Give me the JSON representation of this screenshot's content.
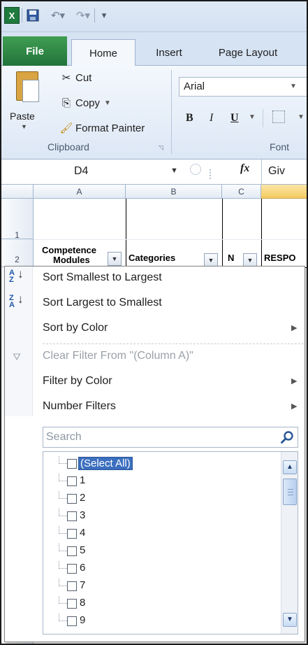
{
  "app": {
    "icon_letter": "X"
  },
  "tabs": {
    "file": "File",
    "home": "Home",
    "insert": "Insert",
    "page_layout": "Page Layout"
  },
  "ribbon": {
    "paste": "Paste",
    "cut": "Cut",
    "copy": "Copy",
    "format_painter": "Format Painter",
    "clipboard_group": "Clipboard",
    "font_name": "Arial",
    "bold": "B",
    "italic": "I",
    "underline": "U",
    "font_group": "Font"
  },
  "formula_bar": {
    "name_box": "D4",
    "fx": "fx",
    "formula": "Giv"
  },
  "sheet": {
    "columns": [
      "A",
      "B",
      "C"
    ],
    "rows": [
      "1",
      "2"
    ],
    "header_a_line1": "Competence",
    "header_a_line2": "Modules",
    "header_b": "Categories",
    "header_c": "N",
    "header_d": "RESPO"
  },
  "filter_menu": {
    "sort_asc": "Sort Smallest to Largest",
    "sort_desc": "Sort Largest to Smallest",
    "sort_by_color": "Sort by Color",
    "clear_filter": "Clear Filter From \"(Column A)\"",
    "filter_by_color": "Filter by Color",
    "number_filters": "Number Filters",
    "search_placeholder": "Search",
    "items": [
      {
        "label": "(Select All)",
        "checked": false,
        "selected": true
      },
      {
        "label": "1",
        "checked": false
      },
      {
        "label": "2",
        "checked": false
      },
      {
        "label": "3",
        "checked": false
      },
      {
        "label": "4",
        "checked": false
      },
      {
        "label": "5",
        "checked": false
      },
      {
        "label": "6",
        "checked": false
      },
      {
        "label": "7",
        "checked": false
      },
      {
        "label": "8",
        "checked": false
      },
      {
        "label": "9",
        "checked": false
      }
    ]
  },
  "colors": {
    "accent_green": "#22733a",
    "selection_blue": "#3b6fbf",
    "active_column": "#f5cb60"
  }
}
